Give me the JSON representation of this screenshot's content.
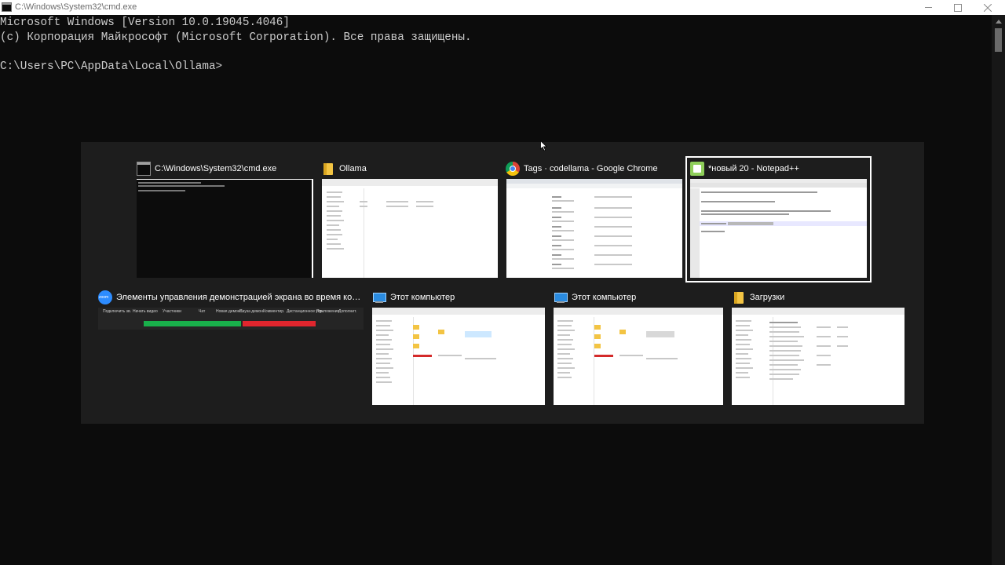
{
  "window": {
    "title": "C:\\Windows\\System32\\cmd.exe"
  },
  "console": {
    "lines": [
      "Microsoft Windows [Version 10.0.19045.4046]",
      "(c) Корпорация Майкрософт (Microsoft Corporation). Все права защищены.",
      "",
      "C:\\Users\\PC\\AppData\\Local\\Ollama>"
    ]
  },
  "switcher": {
    "windows": [
      {
        "title": "C:\\Windows\\System32\\cmd.exe",
        "icon": "cmd-icon",
        "selected": false
      },
      {
        "title": "Ollama",
        "icon": "folder-icon",
        "selected": false
      },
      {
        "title": "Tags · codellama - Google Chrome",
        "icon": "chrome-icon",
        "selected": false
      },
      {
        "title": "*новый 20 - Notepad++",
        "icon": "notepad-plus-plus-icon",
        "selected": true
      },
      {
        "title": "Элементы управления демонстрацией экрана во время кон...",
        "icon": "zoom-icon",
        "selected": false
      },
      {
        "title": "Этот компьютер",
        "icon": "this-pc-icon",
        "selected": false
      },
      {
        "title": "Этот компьютер",
        "icon": "this-pc-icon",
        "selected": false
      },
      {
        "title": "Загрузки",
        "icon": "folder-icon",
        "selected": false
      }
    ]
  },
  "colors": {
    "console_bg": "#0c0c0c",
    "console_fg": "#cccccc",
    "switcher_bg": "#1d1d1d",
    "zoom_green": "#19b04b",
    "zoom_red": "#e0262e"
  }
}
